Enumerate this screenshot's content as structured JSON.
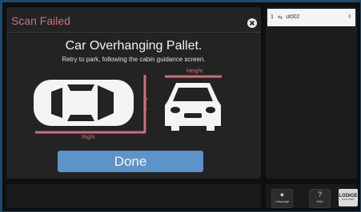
{
  "dialog": {
    "title": "Scan Failed",
    "heading": "Car Overhanging Pallet.",
    "subtext": "Retry to park, following the cabin guidance screen.",
    "labels": {
      "front": "Front",
      "right": "Right",
      "height": "Height"
    },
    "done_label": "Done",
    "accent_color": "#cc6f7a",
    "button_color": "#5c93c8"
  },
  "queue": {
    "rows": [
      {
        "position": "1",
        "icon": "swap-icon",
        "name": "ut002",
        "tail": "¢"
      }
    ]
  },
  "footer": {
    "language_label": "Language",
    "help_label": "Help",
    "logo_text": "LODIGE",
    "logo_tagline": "INDUSTRIES"
  }
}
